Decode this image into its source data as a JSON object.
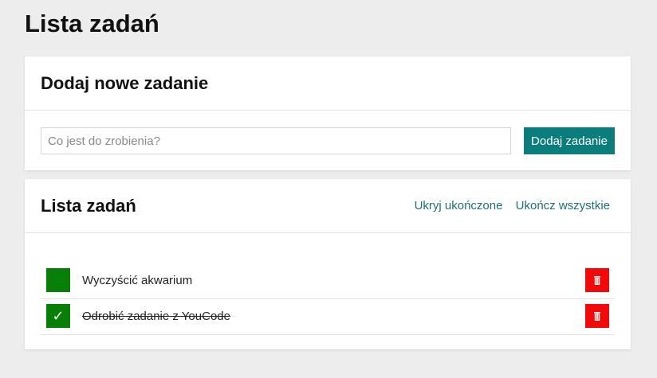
{
  "page": {
    "title": "Lista zadań"
  },
  "add_card": {
    "title": "Dodaj nowe zadanie",
    "input_placeholder": "Co jest do zrobienia?",
    "input_value": "",
    "button_label": "Dodaj zadanie"
  },
  "list_card": {
    "title": "Lista zadań",
    "hide_completed_label": "Ukryj ukończone",
    "complete_all_label": "Ukończ wszystkie",
    "tasks": [
      {
        "label": "Wyczyścić akwarium",
        "done": false
      },
      {
        "label": "Odrobić zadanie z YouCode",
        "done": true
      }
    ]
  },
  "colors": {
    "background": "#ededed",
    "accent": "#0b7d7d",
    "link": "#1f6f73",
    "checkbox": "#088008",
    "delete": "#f20a0a"
  },
  "icons": {
    "check": "check-icon",
    "delete": "trash-icon"
  }
}
